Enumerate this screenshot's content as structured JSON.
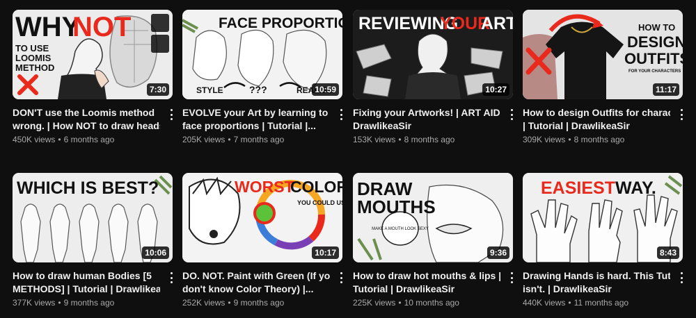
{
  "videos": [
    {
      "thumb_text": [
        "WHY",
        "NOT",
        "TO USE",
        "LOOMIS",
        "METHOD"
      ],
      "duration": "7:30",
      "title_lines": [
        "DON'T use the Loomis method",
        "wrong. | How NOT to draw heads |..."
      ],
      "views": "450K views",
      "age": "6 months ago",
      "hover_icons": [
        "clock-icon",
        "add-to-queue-icon"
      ]
    },
    {
      "thumb_text": [
        "FACE PROPORTIONS",
        "STYLE",
        "???",
        "REALISM"
      ],
      "duration": "10:59",
      "title_lines": [
        "EVOLVE your Art by learning to draw",
        "face proportions | Tutorial |..."
      ],
      "views": "205K views",
      "age": "7 months ago"
    },
    {
      "thumb_text": [
        "REVIEWING",
        "YOUR",
        "ART"
      ],
      "duration": "10:27",
      "title_lines": [
        "Fixing your Artworks! | ART AID |",
        "DrawlikeaSir"
      ],
      "views": "153K views",
      "age": "8 months ago"
    },
    {
      "thumb_text": [
        "HOW TO",
        "DESIGN",
        "OUTFITS",
        "FOR YOUR CHARACTERS"
      ],
      "duration": "11:17",
      "title_lines": [
        "How to design Outfits for characters",
        "| Tutorial | DrawlikeaSir"
      ],
      "views": "309K views",
      "age": "8 months ago"
    },
    {
      "thumb_text": [
        "WHICH IS BEST?"
      ],
      "duration": "10:06",
      "title_lines": [
        "How to draw human Bodies [5",
        "METHODS] | Tutorial | DrawlikeaSir"
      ],
      "views": "377K views",
      "age": "9 months ago"
    },
    {
      "thumb_text": [
        "WORST",
        "COLOR",
        "YOU COULD USE"
      ],
      "duration": "10:17",
      "title_lines": [
        "DO. NOT. Paint with Green (If you",
        "don't know Color Theory) |..."
      ],
      "views": "252K views",
      "age": "9 months ago"
    },
    {
      "thumb_text": [
        "DRAW",
        "MOUTHS",
        "MAKE A MOUTH LOOK SEXY"
      ],
      "duration": "9:36",
      "title_lines": [
        "How to draw hot mouths & lips |",
        "Tutorial | DrawlikeaSir"
      ],
      "views": "225K views",
      "age": "10 months ago"
    },
    {
      "thumb_text": [
        "EASIEST",
        "WAY."
      ],
      "duration": "8:43",
      "title_lines": [
        "Drawing Hands is hard. This Tutorial",
        "isn't. | DrawlikeaSir"
      ],
      "views": "440K views",
      "age": "11 months ago"
    }
  ],
  "colors": {
    "background": "#0f0f0f",
    "accent_red": "#e8291c",
    "meta_text": "#aaaaaa"
  }
}
